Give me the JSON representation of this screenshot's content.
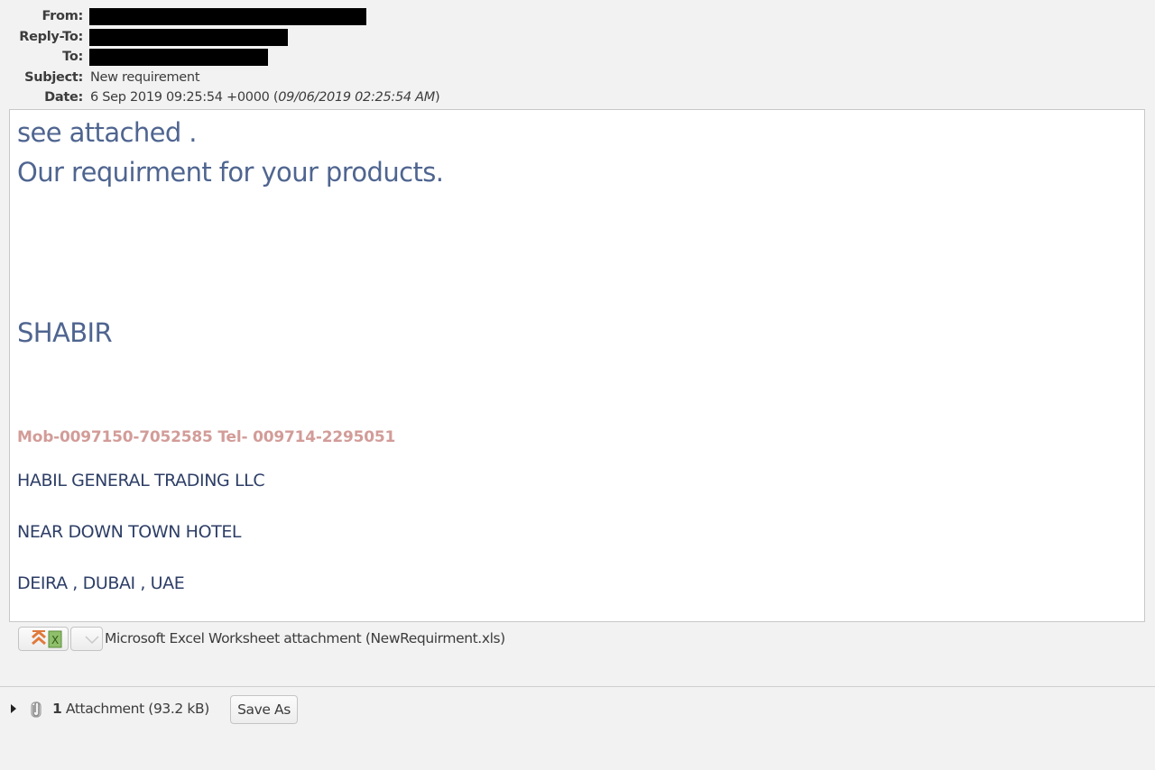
{
  "headers": {
    "from": {
      "label": "From:",
      "value": "[redacted]"
    },
    "reply_to": {
      "label": "Reply-To:",
      "value": "[redacted]"
    },
    "to": {
      "label": "To:",
      "value": "[redacted]"
    },
    "subject": {
      "label": "Subject:",
      "value": "New requirement"
    },
    "date": {
      "label": "Date:",
      "value": "6 Sep 2019 09:25:54 +0000 (",
      "local": "09/06/2019 02:25:54 AM",
      "close": ")"
    }
  },
  "message": {
    "line1": "see attached .",
    "line2": "Our requirment for your products.",
    "signature_name": "SHABIR",
    "phone": "Mob-0097150-7052585 Tel- 009714-2295051",
    "company": "HABIL GENERAL TRADING LLC",
    "address1": "NEAR DOWN TOWN  HOTEL",
    "address2": "DEIRA , DUBAI , UAE"
  },
  "attachment_inline": {
    "open_icon": "excel-open-icon",
    "menu_icon": "chevron-down-icon",
    "label": "Microsoft Excel Worksheet attachment (NewRequirment.xls)"
  },
  "attachments_bar": {
    "expand_icon": "triangle-right-icon",
    "clip_icon": "paperclip-icon",
    "count": "1",
    "label": " Attachment (93.2 kB)",
    "save_as": "Save As"
  },
  "colors": {
    "body_text": "#4f6590",
    "phone_text": "#d29c98",
    "address_text": "#2d3e66",
    "background": "#f2f2f2"
  }
}
